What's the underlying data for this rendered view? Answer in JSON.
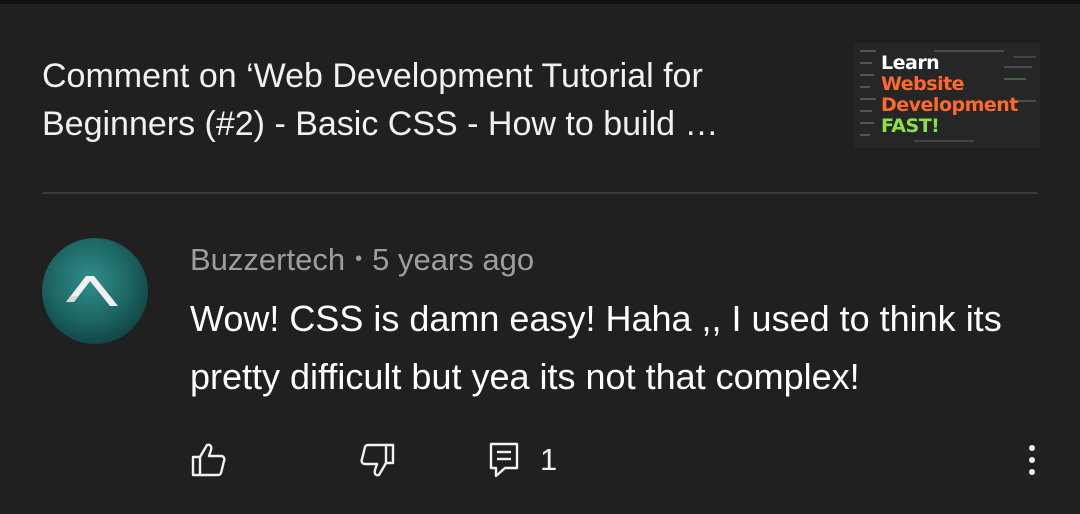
{
  "header": {
    "title": "Comment on ‘Web Development Tutorial for Beginners (#2) - Basic CSS - How to build …",
    "thumbnail": {
      "lines": [
        {
          "text": "Learn",
          "color": "#ffffff"
        },
        {
          "text": "Website",
          "color": "#ff6a2a"
        },
        {
          "text": "Development",
          "color": "#ff6a2a"
        },
        {
          "text": "FAST!",
          "color": "#8ee04a"
        }
      ]
    }
  },
  "comment": {
    "author": "Buzzertech",
    "separator": "•",
    "time": "5 years ago",
    "text": "Wow! CSS is damn easy! Haha ,, I used to think its pretty difficult but yea its not that complex!"
  },
  "actions": {
    "reply_count": "1",
    "icons": [
      "like-icon",
      "dislike-icon",
      "reply-icon",
      "more-vert-icon"
    ]
  },
  "colors": {
    "background": "#202020",
    "divider": "#3a3a3a",
    "secondary_text": "#9e9e9e",
    "avatar": "#1e6866"
  }
}
